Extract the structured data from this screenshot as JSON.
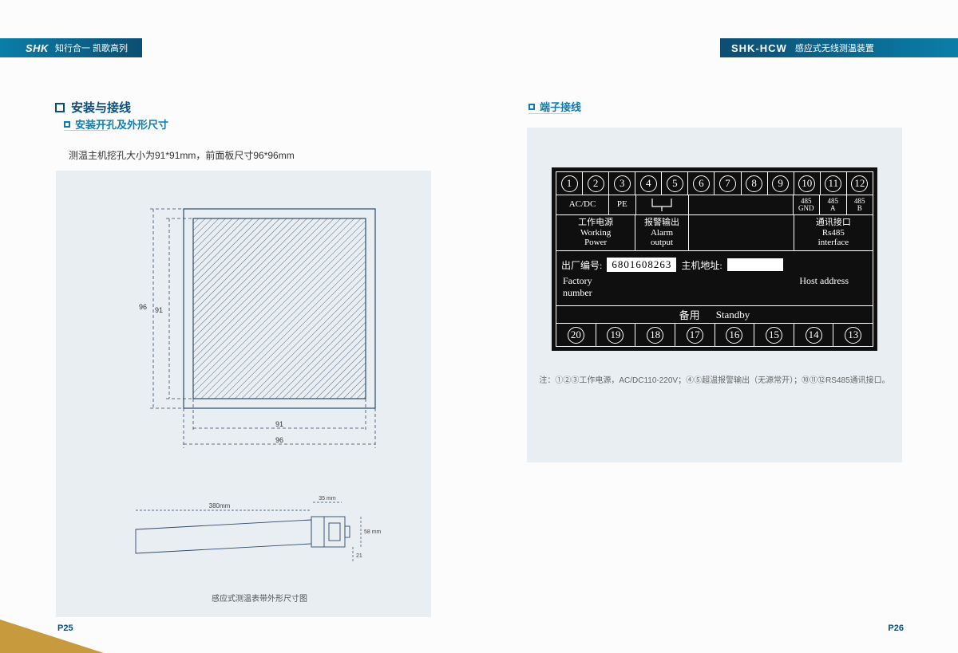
{
  "header": {
    "brand": "SHK",
    "slogan": "知行合一 凯歌高列",
    "product_code": "SHK-HCW",
    "product_name": "感应式无线测温装置"
  },
  "left": {
    "title_main": "安装与接线",
    "title_sub": "安装开孔及外形尺寸",
    "body": "测温主机挖孔大小为91*91mm，前面板尺寸96*96mm",
    "dim_96": "96",
    "dim_91": "91",
    "dash_91": "91",
    "dash_96": "96",
    "strap_len": "380mm",
    "strap_w": "35 mm",
    "strap_h1": "58 mm",
    "strap_h2": "21",
    "caption": "感应式测温表带外形尺寸图",
    "page": "P25"
  },
  "right": {
    "title": "端子接线",
    "terminals_top": [
      "1",
      "2",
      "3",
      "4",
      "5",
      "6",
      "7",
      "8",
      "9",
      "10",
      "11",
      "12"
    ],
    "signals": {
      "acdc": "AC/DC",
      "pe": "PE",
      "gnd": "485\nGND",
      "a": "485\nA",
      "b": "485\nB"
    },
    "labels": {
      "power_cn": "工作电源",
      "power_en1": "Working",
      "power_en2": "Power",
      "alarm_cn": "报警输出",
      "alarm_en1": "Alarm",
      "alarm_en2": "output",
      "comm_cn": "通讯接口",
      "comm_en1": "Rs485",
      "comm_en2": "interface"
    },
    "factory_label_cn": "出厂编号:",
    "factory_number": "6801608263",
    "host_label_cn": "主机地址:",
    "factory_en": "Factory",
    "number_en": "number",
    "host_en": "Host address",
    "standby_cn": "备用",
    "standby_en": "Standby",
    "terminals_bottom": [
      "20",
      "19",
      "18",
      "17",
      "16",
      "15",
      "14",
      "13"
    ],
    "footnote": "注：①②③工作电源，AC/DC110-220V；④⑤超温报警输出（无源常开）；⑩⑪⑫RS485通讯接口。",
    "page": "P26"
  }
}
